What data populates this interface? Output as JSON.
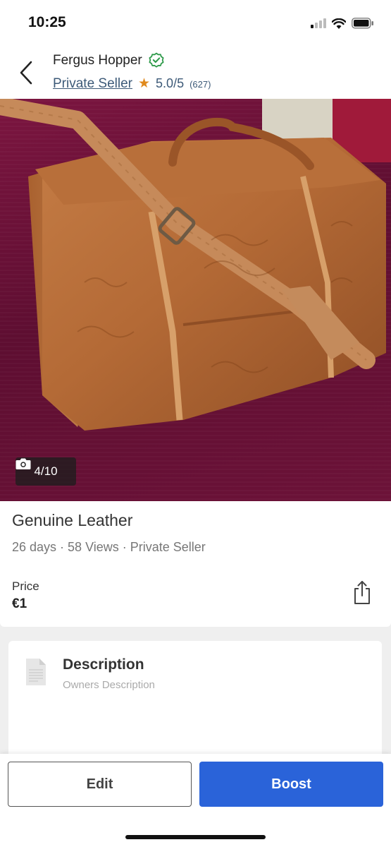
{
  "status_bar": {
    "time": "10:25",
    "icons": [
      "cellular-signal-icon",
      "wifi-icon",
      "battery-icon"
    ]
  },
  "header": {
    "back_icon": "chevron-left-icon",
    "seller_name": "Fergus Hopper",
    "verified_icon": "verified-badge-icon",
    "seller_type_link": "Private Seller",
    "rating_star": "★",
    "rating": "5.0/5",
    "review_count": "(627)"
  },
  "photo": {
    "counter_icon": "camera-icon",
    "counter": "4/10"
  },
  "listing": {
    "title": "Genuine Leather",
    "meta": "26 days · 58 Views · Private Seller",
    "price_label": "Price",
    "price_value": "€1",
    "share_icon": "share-icon"
  },
  "description": {
    "icon": "document-icon",
    "title": "Description",
    "subtitle": "Owners Description"
  },
  "actions": {
    "edit_label": "Edit",
    "boost_label": "Boost"
  },
  "colors": {
    "accent": "#2a63d9",
    "star": "#e08a1e",
    "verified": "#2e9a4a",
    "link": "#3d5a78"
  }
}
